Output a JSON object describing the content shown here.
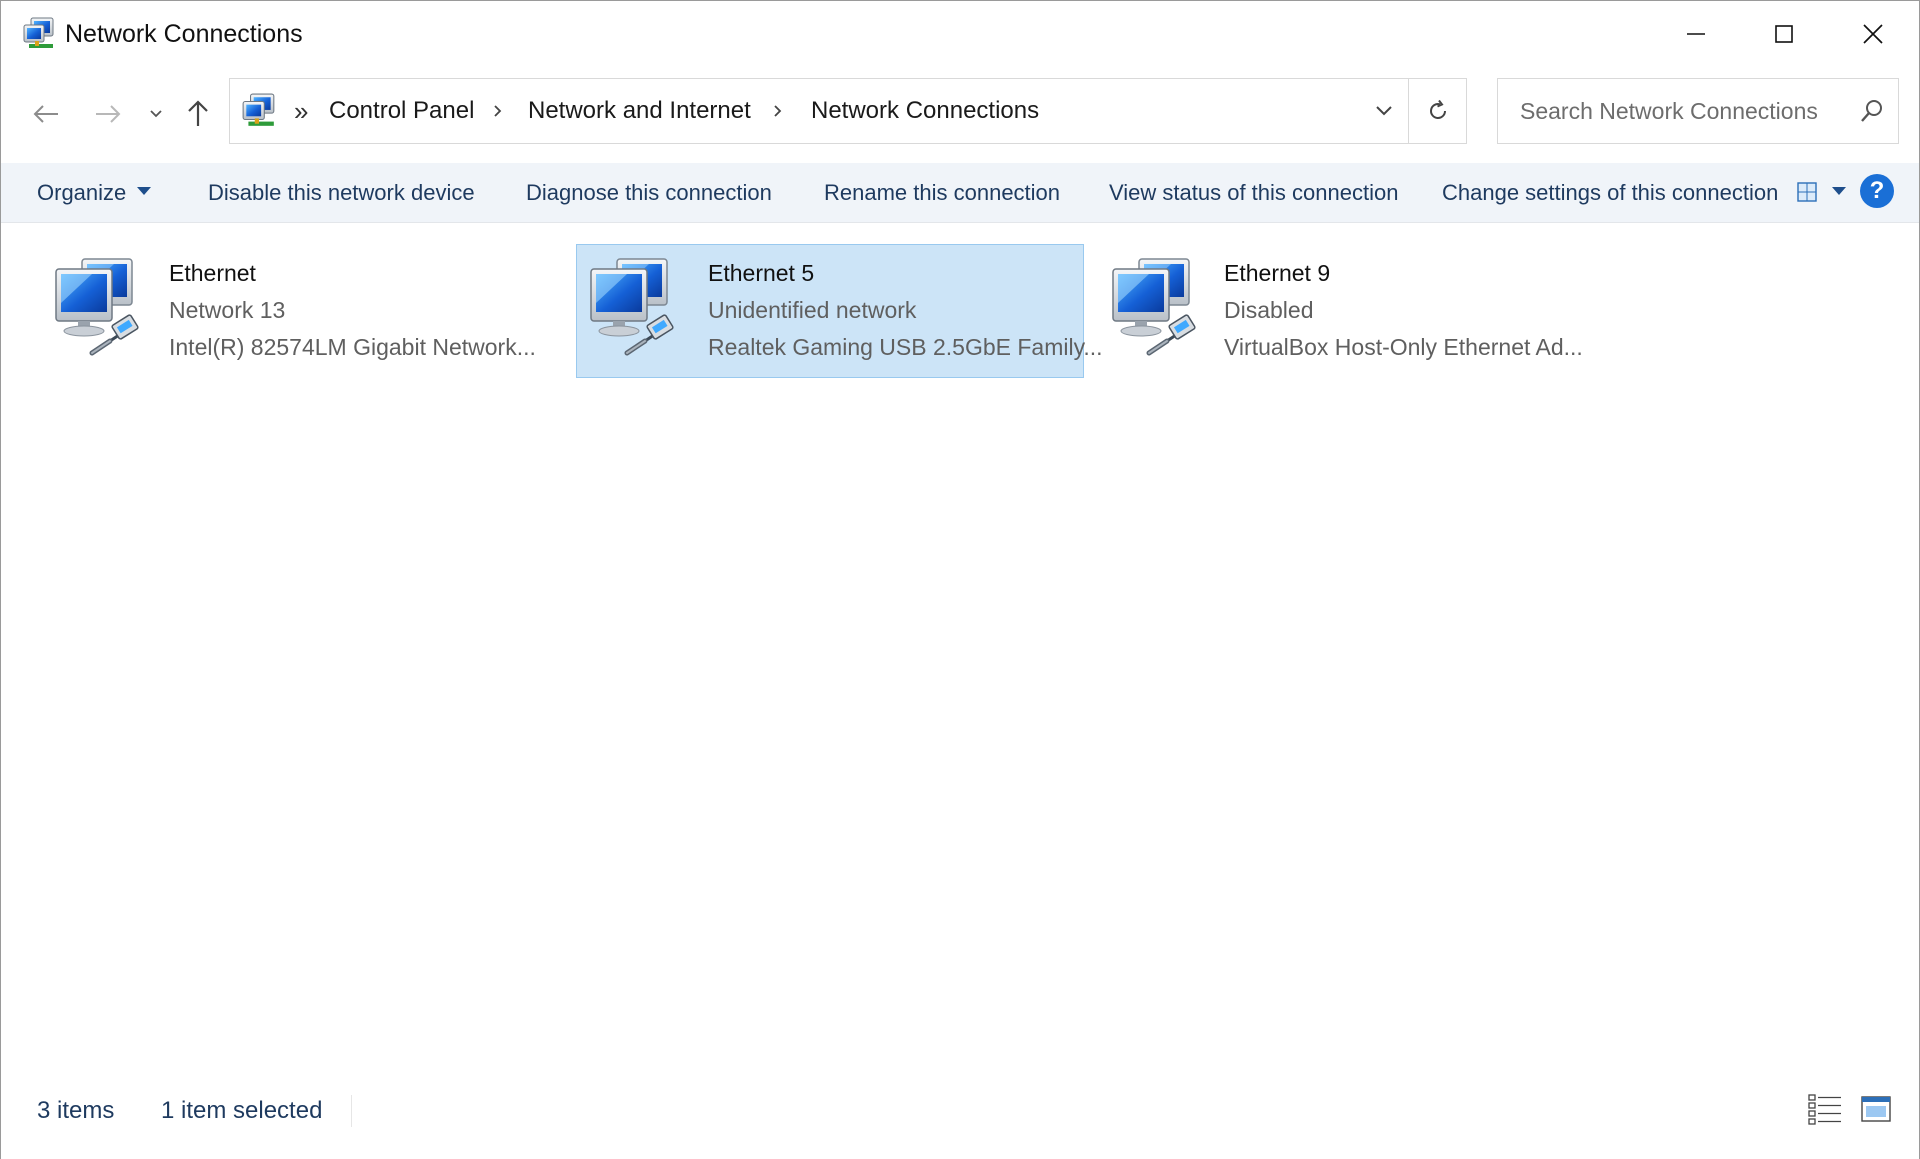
{
  "window": {
    "title": "Network Connections",
    "icon": "network-connections-icon",
    "controls": {
      "minimize": "minimize-icon",
      "maximize": "maximize-icon",
      "close": "close-icon"
    }
  },
  "nav": {
    "back_icon": "back-arrow-icon",
    "forward_icon": "forward-arrow-icon",
    "recent_icon": "chevron-down-icon",
    "up_icon": "up-arrow-icon"
  },
  "address": {
    "overflow": "»",
    "crumbs": [
      "Control Panel",
      "Network and Internet",
      "Network Connections"
    ],
    "dropdown_icon": "chevron-down-icon",
    "refresh_icon": "refresh-icon"
  },
  "search": {
    "placeholder": "Search Network Connections",
    "icon": "search-icon"
  },
  "commands": {
    "organize": "Organize",
    "disable": "Disable this network device",
    "diagnose": "Diagnose this connection",
    "rename": "Rename this connection",
    "view_status": "View status of this connection",
    "change_settings": "Change settings of this connection",
    "help": "?"
  },
  "items": [
    {
      "name": "Ethernet",
      "status": "Network 13",
      "adapter": "Intel(R) 82574LM Gigabit Network...",
      "selected": false,
      "icon": "ethernet-connection-icon"
    },
    {
      "name": "Ethernet 5",
      "status": "Unidentified network",
      "adapter": "Realtek Gaming USB 2.5GbE Family...",
      "selected": true,
      "icon": "ethernet-connection-icon"
    },
    {
      "name": "Ethernet 9",
      "status": "Disabled",
      "adapter": "VirtualBox Host-Only Ethernet Ad...",
      "selected": false,
      "icon": "ethernet-connection-icon"
    }
  ],
  "status": {
    "count": "3 items",
    "selected": "1 item selected"
  },
  "colors": {
    "selection_bg": "#cce4f7",
    "selection_border": "#99c9ef",
    "command_bar_bg": "#f0f4f9",
    "command_text": "#1e3a5f",
    "help_blue": "#1a6fd6"
  }
}
